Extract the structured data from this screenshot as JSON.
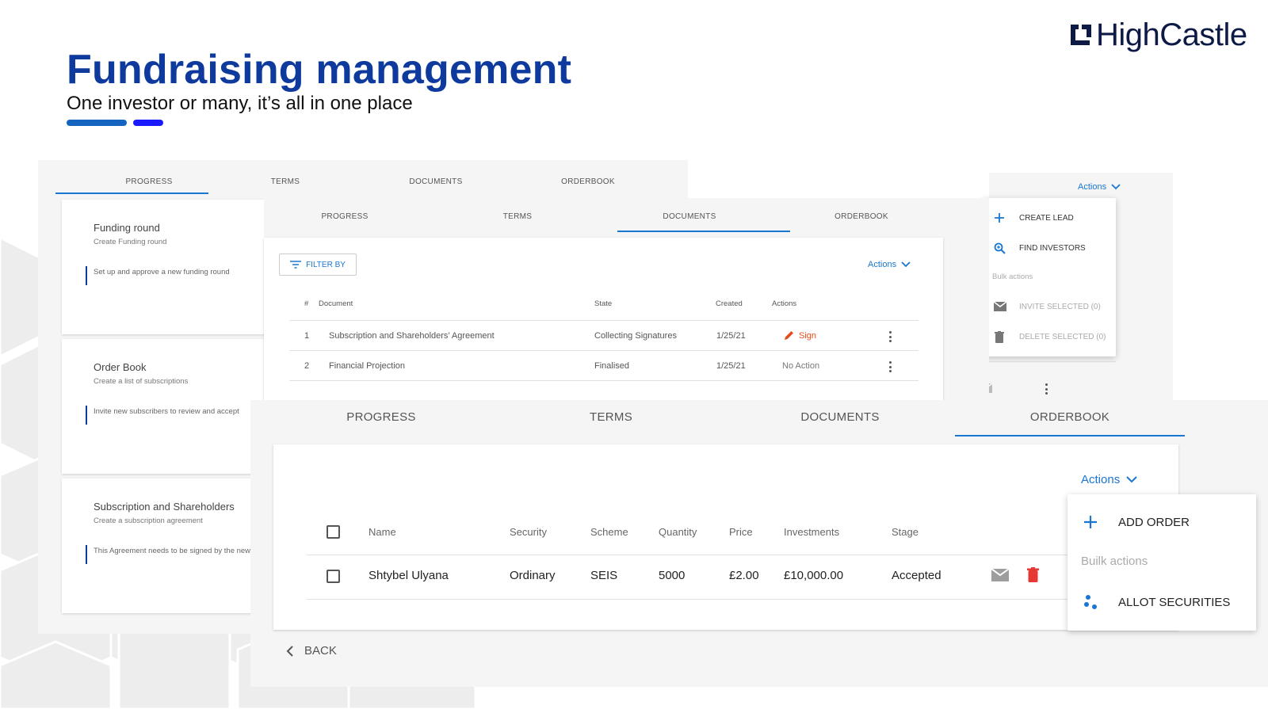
{
  "header": {
    "title": "Fundraising management",
    "subtitle": "One investor or many, it’s all in one place",
    "logo_text": "HighCastle",
    "accent_colors": [
      "#1565c0",
      "#1a1aff"
    ],
    "title_color": "#0d3a9c"
  },
  "progress_screen": {
    "tabs": [
      "PROGRESS",
      "TERMS",
      "DOCUMENTS",
      "ORDERBOOK"
    ],
    "active_tab": "PROGRESS",
    "steps": [
      {
        "title": "Funding round",
        "subtitle": "Create Funding round",
        "note": "Set up and approve a new funding round"
      },
      {
        "title": "Order Book",
        "subtitle": "Create a list of subscriptions",
        "note": "Invite new subscribers to review and accept"
      },
      {
        "title": "Subscription and Shareholders",
        "subtitle": "Create a subscription agreement",
        "note": "This Agreement needs to be signed by the new"
      }
    ]
  },
  "leads_screen": {
    "actions_label": "Actions",
    "menu": {
      "create_lead": "CREATE LEAD",
      "find_investors": "FIND INVESTORS",
      "bulk_actions": "Bulk actions",
      "invite_selected": "INVITE SELECTED (0)",
      "delete_selected": "DELETE SELECTED (0)"
    }
  },
  "documents_screen": {
    "tabs": [
      "PROGRESS",
      "TERMS",
      "DOCUMENTS",
      "ORDERBOOK"
    ],
    "active_tab": "DOCUMENTS",
    "filter_label": "FILTER BY",
    "actions_label": "Actions",
    "columns": [
      "#",
      "Document",
      "State",
      "Created",
      "Actions"
    ],
    "rows": [
      {
        "num": "1",
        "document": "Subscription and Shareholders’ Agreement",
        "state": "Collecting Signatures",
        "created": "1/25/21",
        "action": "Sign",
        "action_type": "sign"
      },
      {
        "num": "2",
        "document": "Financial Projection",
        "state": "Finalised",
        "created": "1/25/21",
        "action": "No Action",
        "action_type": "none"
      }
    ],
    "sign_color": "#e64a19"
  },
  "orderbook_screen": {
    "tabs": [
      "PROGRESS",
      "TERMS",
      "DOCUMENTS",
      "ORDERBOOK"
    ],
    "active_tab": "ORDERBOOK",
    "actions_label": "Actions",
    "columns": [
      "Name",
      "Security",
      "Scheme",
      "Quantity",
      "Price",
      "Investments",
      "Stage"
    ],
    "rows": [
      {
        "name": "Shtybel Ulyana",
        "security": "Ordinary",
        "scheme": "SEIS",
        "quantity": "5000",
        "price": "£2.00",
        "investments": "£10,000.00",
        "stage": "Accepted"
      }
    ],
    "menu": {
      "add_order": "ADD ORDER",
      "bulk_actions": "Builk actions",
      "allot_securities": "ALLOT SECURITIES"
    },
    "back_label": "BACK",
    "accent_color": "#1976d2",
    "delete_color": "#e53935"
  }
}
